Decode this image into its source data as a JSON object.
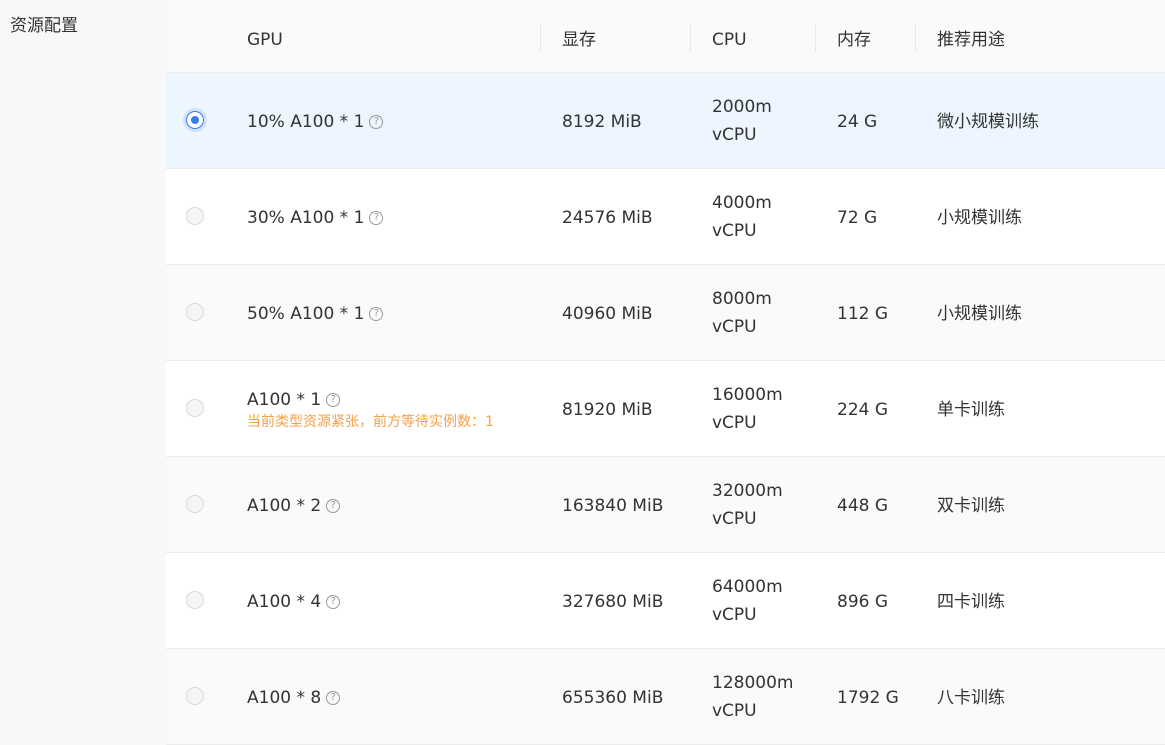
{
  "section_label": "资源配置",
  "columns": {
    "gpu": "GPU",
    "vram": "显存",
    "cpu": "CPU",
    "mem": "内存",
    "use": "推荐用途"
  },
  "help_icon": "question-circle-icon",
  "colors": {
    "accent": "#3a7bf0",
    "selected_row": "#edf5ff",
    "warning": "#f5a14a"
  },
  "rows": [
    {
      "gpu": "10% A100 * 1",
      "warning": "",
      "vram": "8192 MiB",
      "cpu_value": "2000m",
      "cpu_unit": "vCPU",
      "mem": "24 G",
      "use": "微小规模训练",
      "selected": true
    },
    {
      "gpu": "30% A100 * 1",
      "warning": "",
      "vram": "24576 MiB",
      "cpu_value": "4000m",
      "cpu_unit": "vCPU",
      "mem": "72 G",
      "use": "小规模训练",
      "selected": false
    },
    {
      "gpu": "50% A100 * 1",
      "warning": "",
      "vram": "40960 MiB",
      "cpu_value": "8000m",
      "cpu_unit": "vCPU",
      "mem": "112 G",
      "use": "小规模训练",
      "selected": false
    },
    {
      "gpu": "A100 * 1",
      "warning": "当前类型资源紧张，前方等待实例数：1",
      "vram": "81920 MiB",
      "cpu_value": "16000m",
      "cpu_unit": "vCPU",
      "mem": "224 G",
      "use": "单卡训练",
      "selected": false
    },
    {
      "gpu": "A100 * 2",
      "warning": "",
      "vram": "163840 MiB",
      "cpu_value": "32000m",
      "cpu_unit": "vCPU",
      "mem": "448 G",
      "use": "双卡训练",
      "selected": false
    },
    {
      "gpu": "A100 * 4",
      "warning": "",
      "vram": "327680 MiB",
      "cpu_value": "64000m",
      "cpu_unit": "vCPU",
      "mem": "896 G",
      "use": "四卡训练",
      "selected": false
    },
    {
      "gpu": "A100 * 8",
      "warning": "",
      "vram": "655360 MiB",
      "cpu_value": "128000m",
      "cpu_unit": "vCPU",
      "mem": "1792 G",
      "use": "八卡训练",
      "selected": false
    }
  ]
}
